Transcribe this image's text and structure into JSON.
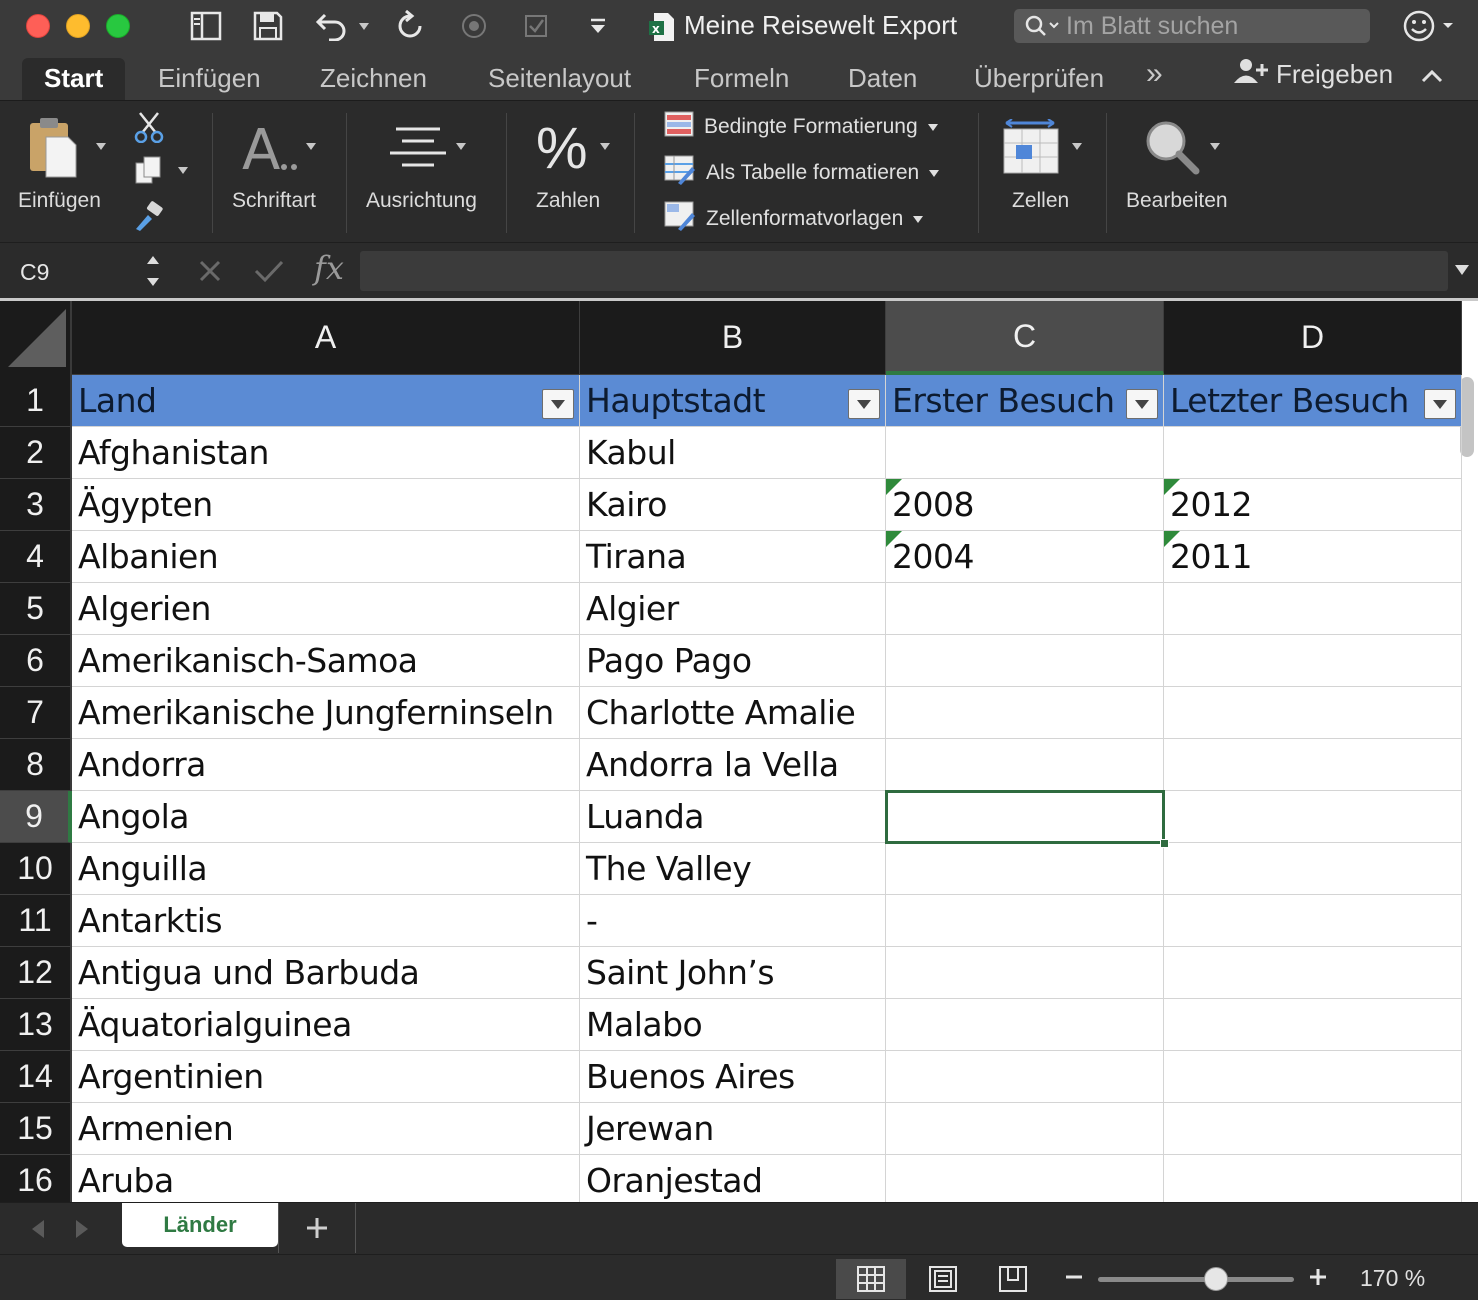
{
  "window": {
    "title": "Meine Reisewelt Export",
    "search_placeholder": "Im Blatt suchen"
  },
  "ribbon_tabs": [
    "Start",
    "Einfügen",
    "Zeichnen",
    "Seitenlayout",
    "Formeln",
    "Daten",
    "Überprüfen"
  ],
  "active_tab": "Start",
  "more_tabs_glyph": "»",
  "share_label": "Freigeben",
  "ribbon": {
    "paste_label": "Einfügen",
    "font_label": "Schriftart",
    "align_label": "Ausrichtung",
    "number_label": "Zahlen",
    "conditional_format": "Bedingte Formatierung",
    "format_as_table": "Als Tabelle formatieren",
    "cell_styles": "Zellenformatvorlagen",
    "cells_label": "Zellen",
    "edit_label": "Bearbeiten"
  },
  "formula_bar": {
    "name_box": "C9",
    "fx_glyph": "fx",
    "formula": ""
  },
  "columns": [
    "A",
    "B",
    "C",
    "D"
  ],
  "selected_column": "C",
  "selected_row": 9,
  "rows": [
    {
      "num": "1",
      "cells": [
        "Land",
        "Hauptstadt",
        "Erster Besuch",
        "Letzter Besuch"
      ]
    },
    {
      "num": "2",
      "cells": [
        "Afghanistan",
        "Kabul",
        "",
        ""
      ]
    },
    {
      "num": "3",
      "cells": [
        "Ägypten",
        "Kairo",
        "2008",
        "2012"
      ]
    },
    {
      "num": "4",
      "cells": [
        "Albanien",
        "Tirana",
        "2004",
        "2011"
      ]
    },
    {
      "num": "5",
      "cells": [
        "Algerien",
        "Algier",
        "",
        ""
      ]
    },
    {
      "num": "6",
      "cells": [
        "Amerikanisch-Samoa",
        "Pago Pago",
        "",
        ""
      ]
    },
    {
      "num": "7",
      "cells": [
        "Amerikanische Jungferninseln",
        "Charlotte Amalie",
        "",
        ""
      ]
    },
    {
      "num": "8",
      "cells": [
        "Andorra",
        "Andorra la Vella",
        "",
        ""
      ]
    },
    {
      "num": "9",
      "cells": [
        "Angola",
        "Luanda",
        "",
        ""
      ]
    },
    {
      "num": "10",
      "cells": [
        "Anguilla",
        "The Valley",
        "",
        ""
      ]
    },
    {
      "num": "11",
      "cells": [
        "Antarktis",
        "-",
        "",
        ""
      ]
    },
    {
      "num": "12",
      "cells": [
        "Antigua und Barbuda",
        "Saint John’s",
        "",
        ""
      ]
    },
    {
      "num": "13",
      "cells": [
        "Äquatorialguinea",
        "Malabo",
        "",
        ""
      ]
    },
    {
      "num": "14",
      "cells": [
        "Argentinien",
        "Buenos Aires",
        "",
        ""
      ]
    },
    {
      "num": "15",
      "cells": [
        "Armenien",
        "Jerewan",
        "",
        ""
      ]
    },
    {
      "num": "16",
      "cells": [
        "Aruba",
        "Oranjestad",
        "",
        ""
      ]
    }
  ],
  "sheet_tab": "Länder",
  "zoom": "170 %",
  "colors": {
    "header_fill": "#5b8bd4",
    "selection": "#2f6b3f",
    "accent_green": "#2f7a43"
  }
}
